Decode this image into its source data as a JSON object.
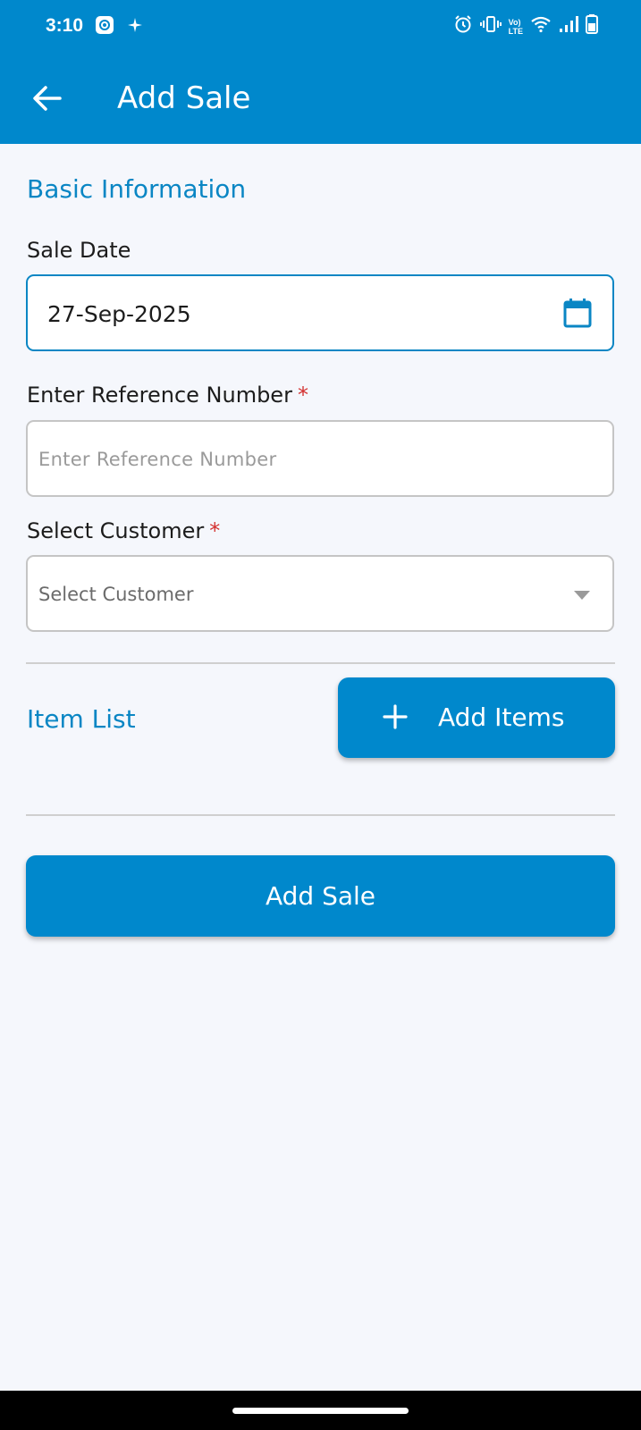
{
  "status_bar": {
    "time": "3:10",
    "left_icons": [
      "gear-notification-icon",
      "sparkle-icon"
    ],
    "right_icons": [
      "alarm-icon",
      "vibrate-icon",
      "volte-icon",
      "wifi-icon",
      "signal-icon",
      "battery-icon"
    ],
    "volte_label_top": "Vo)",
    "volte_label_bottom": "LTE"
  },
  "header": {
    "title": "Add Sale",
    "back_icon": "arrow-left-icon"
  },
  "basic_info": {
    "section_title": "Basic Information",
    "sale_date": {
      "label": "Sale Date",
      "value": "27-Sep-2025",
      "icon": "calendar-icon"
    },
    "reference": {
      "label": "Enter Reference Number",
      "required_mark": "*",
      "value": "",
      "placeholder": "Enter Reference Number"
    },
    "customer": {
      "label": "Select Customer",
      "required_mark": "*",
      "selected": "Select Customer",
      "icon": "chevron-down-icon"
    }
  },
  "item_list": {
    "section_title": "Item List",
    "add_button_label": "Add Items",
    "add_icon": "plus-icon"
  },
  "submit": {
    "label": "Add Sale"
  },
  "colors": {
    "primary": "#0088cc",
    "section_title": "#0a86c4",
    "required": "#d3302f",
    "background": "#f5f7fc"
  }
}
